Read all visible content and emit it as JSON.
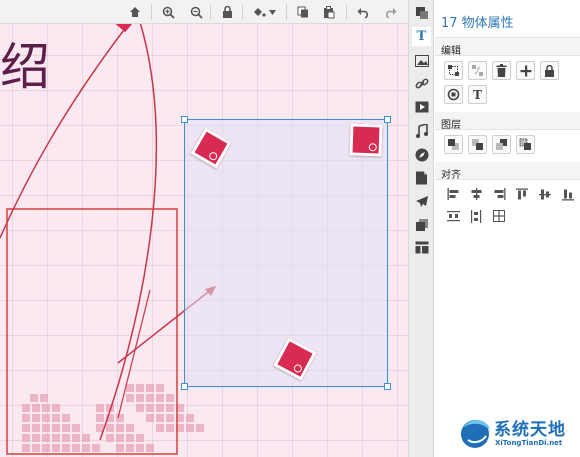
{
  "canvas": {
    "title_text": "绍"
  },
  "top_toolbar": {
    "icons": [
      "home-icon",
      "zoom-in-icon",
      "zoom-out-icon",
      "lock-icon",
      "fill-color-icon",
      "dropdown-icon",
      "copy-icon",
      "paste-icon",
      "undo-icon",
      "redo-icon"
    ]
  },
  "icon_strip": {
    "items": [
      "layers-icon",
      "text-icon",
      "image-icon",
      "link-icon",
      "video-icon",
      "music-icon",
      "compass-icon",
      "page-icon",
      "plane-icon",
      "stack-icon",
      "layout-icon"
    ],
    "text_label": "T"
  },
  "properties": {
    "title": "17 物体属性",
    "edit_section": "编辑",
    "edit_text_button": "T",
    "layer_section": "图层",
    "align_section": "对齐"
  },
  "watermark": {
    "text": "系统天地",
    "sub": "XiTongTianDi.net"
  },
  "colors": {
    "accent": "#2f79b5",
    "selection": "#3d8fd6",
    "sticker": "#d92a52",
    "canvas_bg": "#fbe9f2",
    "line": "#c9344a"
  }
}
